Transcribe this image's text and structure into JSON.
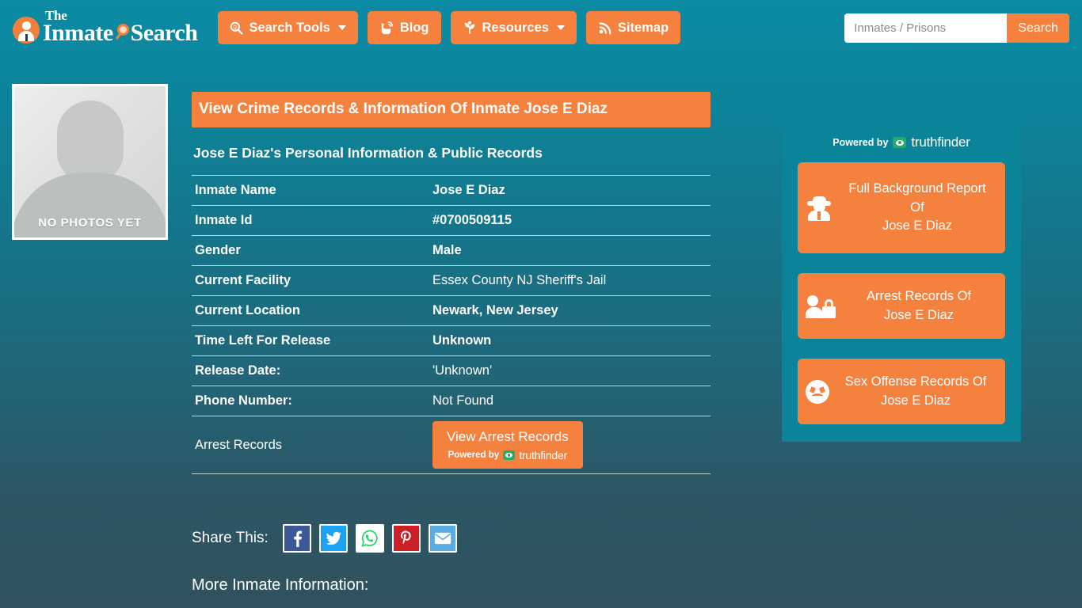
{
  "site": {
    "logo_the": "The",
    "logo_inmate": "Inmate",
    "logo_search": "Search"
  },
  "nav": {
    "items": [
      {
        "label": "Search Tools",
        "icon": "magnifier-icon",
        "caret": true
      },
      {
        "label": "Blog",
        "icon": "blogger-icon",
        "caret": false
      },
      {
        "label": "Resources",
        "icon": "leaf-icon",
        "caret": true
      },
      {
        "label": "Sitemap",
        "icon": "rss-icon",
        "caret": false
      }
    ]
  },
  "search": {
    "placeholder": "Inmates / Prisons",
    "value": "",
    "button_label": "Search"
  },
  "photo": {
    "caption": "NO PHOTOS YET"
  },
  "main": {
    "title": "View Crime Records & Information Of Inmate Jose E Diaz",
    "subtitle": "Jose E Diaz's Personal Information & Public Records",
    "table": [
      {
        "label": "Inmate Name",
        "value": "Jose E Diaz",
        "label_bold": true,
        "value_bold": true
      },
      {
        "label": "Inmate Id",
        "value": "#0700509115",
        "label_bold": true,
        "value_bold": true
      },
      {
        "label": "Gender",
        "value": "Male",
        "label_bold": true,
        "value_bold": true
      },
      {
        "label": "Current Facility",
        "value": "Essex County NJ Sheriff's Jail",
        "label_bold": true,
        "value_bold": false
      },
      {
        "label": "Current Location",
        "value": "Newark, New Jersey",
        "label_bold": true,
        "value_bold": true
      },
      {
        "label": "Time Left For Release",
        "value": "Unknown",
        "label_bold": true,
        "value_bold": true
      },
      {
        "label": "Release Date:",
        "value": "'Unknown'",
        "label_bold": true,
        "value_bold": false
      },
      {
        "label": "Phone Number:",
        "value": "Not Found",
        "label_bold": true,
        "value_bold": false
      }
    ],
    "arrest_row": {
      "label": "Arrest Records",
      "button_label": "View Arrest Records",
      "powered_by": "Powered by",
      "brand": "truthfinder"
    }
  },
  "share": {
    "label": "Share This:",
    "icons": [
      {
        "name": "facebook-icon",
        "glyph": "f"
      },
      {
        "name": "twitter-icon",
        "glyph": "✈"
      },
      {
        "name": "whatsapp-icon",
        "glyph": "✆"
      },
      {
        "name": "pinterest-icon",
        "glyph": "P"
      },
      {
        "name": "email-icon",
        "glyph": "✉"
      }
    ]
  },
  "more_info_heading": "More Inmate Information:",
  "sidebar": {
    "powered_by": "Powered by",
    "brand": "truthfinder",
    "buttons": [
      {
        "icon": "detective-icon",
        "line1": "Full Background Report",
        "line2": "Of",
        "line3": "Jose E Diaz"
      },
      {
        "icon": "person-lock-icon",
        "line1": "Arrest Records Of",
        "line2": "Jose E Diaz",
        "line3": ""
      },
      {
        "icon": "angry-face-icon",
        "line1": "Sex Offense Records Of",
        "line2": "Jose E Diaz",
        "line3": ""
      }
    ]
  },
  "colors": {
    "accent_orange": "#f5813f",
    "bg_teal_top": "#0c8ba4",
    "bg_slate_bottom": "#31525f",
    "sidebar_teal": "#0b8499",
    "truthfinder_green": "#2aa86a"
  }
}
